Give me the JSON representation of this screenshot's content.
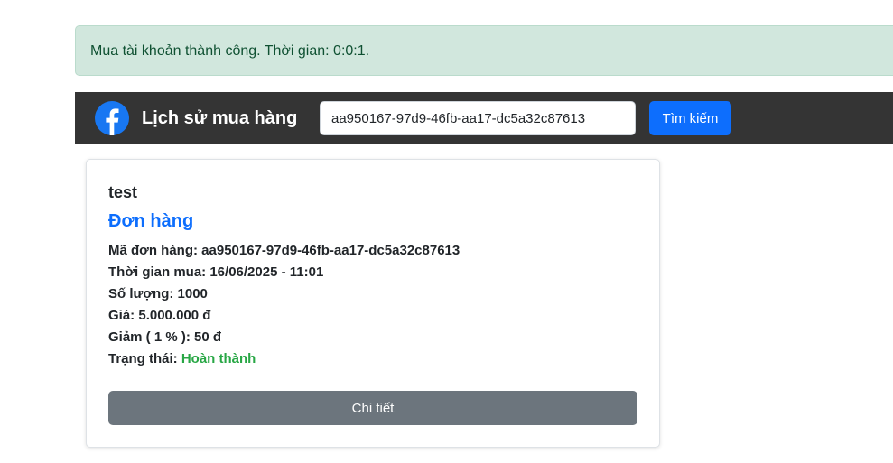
{
  "alert": {
    "message": "Mua tài khoản thành công. Thời gian: 0:0:1."
  },
  "navbar": {
    "brand_icon": "facebook-icon",
    "brand_text": "Lịch sử mua hàng",
    "search_value": "aa950167-97d9-46fb-aa17-dc5a32c87613",
    "search_button": "Tìm kiếm"
  },
  "order": {
    "user": "test",
    "title": "Đơn hàng",
    "order_id_label": "Mã đơn hàng:",
    "order_id_value": "aa950167-97d9-46fb-aa17-dc5a32c87613",
    "time_label": "Thời gian mua:",
    "time_value": "16/06/2025 - 11:01",
    "quantity_label": "Số lượng:",
    "quantity_value": "1000",
    "price_label": "Giá:",
    "price_value": "5.000.000 đ",
    "discount_label": "Giảm ( 1 % ):",
    "discount_value": "50 đ",
    "status_label": "Trạng thái:",
    "status_value": "Hoàn thành",
    "detail_button": "Chi tiết"
  },
  "colors": {
    "alert_bg": "#d1e7dd",
    "navbar_bg": "#343434",
    "primary": "#0d6efd",
    "secondary": "#6c757d",
    "success": "#28a745",
    "facebook_blue": "#1877f2"
  }
}
